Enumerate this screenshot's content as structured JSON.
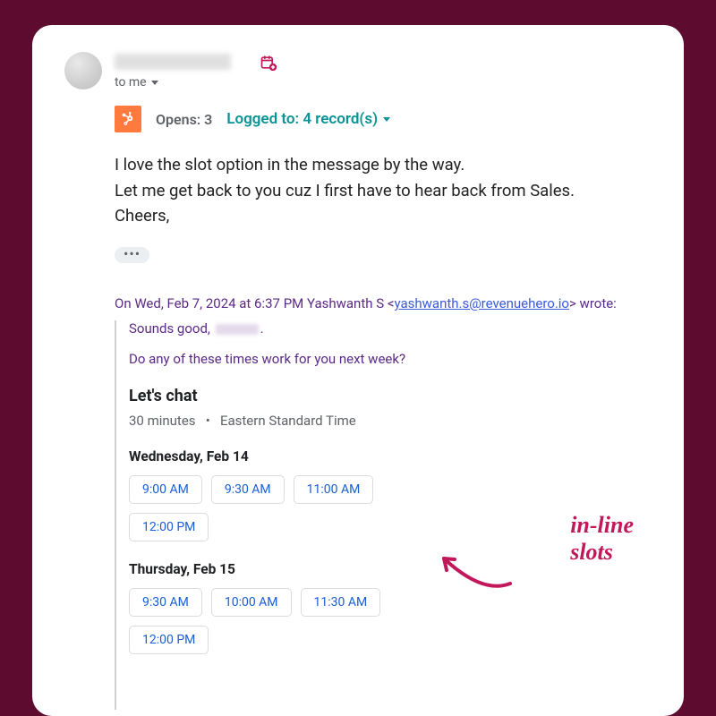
{
  "header": {
    "to_label": "to me"
  },
  "tracking": {
    "opens_label": "Opens: 3",
    "logged_label": "Logged to: 4 record(s)"
  },
  "body": {
    "line1": "I love the slot option in the message by the way.",
    "line2": "Let me get back to you cuz I first have to hear back from Sales.",
    "line3": "Cheers,"
  },
  "ellipsis": "•••",
  "quoted": {
    "prefix": "On Wed, Feb 7, 2024 at 6:37 PM Yashwanth S <",
    "email": "yashwanth.s@revenuehero.io",
    "suffix": "> wrote:",
    "reply_prefix": "Sounds good, ",
    "reply_suffix": ".",
    "question": "Do any of these times work for you next week?"
  },
  "widget": {
    "title": "Let's chat",
    "duration": "30 minutes",
    "dot": "•",
    "tz": "Eastern Standard Time",
    "days": [
      {
        "label": "Wednesday, Feb 14",
        "slots": [
          "9:00 AM",
          "9:30 AM",
          "11:00 AM",
          "12:00 PM"
        ]
      },
      {
        "label": "Thursday, Feb 15",
        "slots": [
          "9:30 AM",
          "10:00 AM",
          "11:30 AM",
          "12:00 PM"
        ]
      }
    ]
  },
  "annotation": {
    "line1": "in-line",
    "line2": "slots"
  }
}
